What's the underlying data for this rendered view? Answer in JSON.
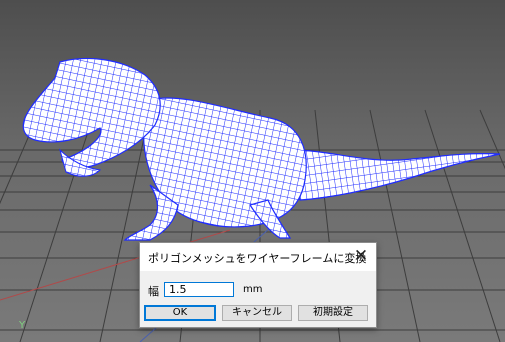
{
  "viewport": {
    "axis_label": "Y",
    "wire_color": "#1f2cff"
  },
  "dialog": {
    "title": "ポリゴンメッシュをワイヤーフレームに変換",
    "close_glyph": "✕",
    "width_label": "幅",
    "width_value": "1.5",
    "unit": "mm",
    "ok_label": "OK",
    "cancel_label": "キャンセル",
    "reset_label": "初期設定"
  }
}
